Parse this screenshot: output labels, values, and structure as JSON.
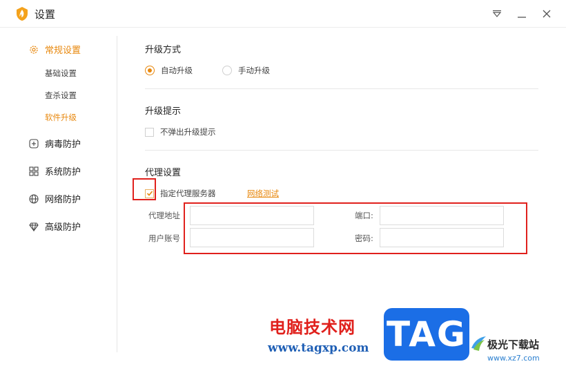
{
  "window": {
    "title": "设置"
  },
  "sidebar": {
    "groups": [
      {
        "label": "常规设置",
        "icon": "gear-icon",
        "active": true
      },
      {
        "label": "病毒防护",
        "icon": "plus-square-icon"
      },
      {
        "label": "系统防护",
        "icon": "grid-icon"
      },
      {
        "label": "网络防护",
        "icon": "globe-icon"
      },
      {
        "label": "高级防护",
        "icon": "diamond-icon"
      }
    ],
    "subitems": [
      {
        "label": "基础设置"
      },
      {
        "label": "查杀设置"
      },
      {
        "label": "软件升级",
        "active": true
      }
    ]
  },
  "upgrade_mode": {
    "title": "升级方式",
    "options": [
      {
        "label": "自动升级",
        "selected": true
      },
      {
        "label": "手动升级",
        "selected": false
      }
    ]
  },
  "upgrade_prompt": {
    "title": "升级提示",
    "checkbox_label": "不弹出升级提示",
    "checked": false
  },
  "proxy": {
    "title": "代理设置",
    "checkbox_label": "指定代理服务器",
    "checked": true,
    "test_link": "网络测试",
    "address_label": "代理地址",
    "port_label": "端口:",
    "user_label": "用户账号",
    "password_label": "密码:",
    "address_value": "",
    "port_value": "",
    "user_value": "",
    "password_value": ""
  },
  "watermark": {
    "site_name": "电脑技术网",
    "site_url": "www.tagxp.com",
    "tag": "TAG",
    "xz_name": "极光下载站",
    "xz_url": "www.xz7.com"
  },
  "colors": {
    "accent": "#e8880e",
    "annotation": "#e0201c"
  }
}
